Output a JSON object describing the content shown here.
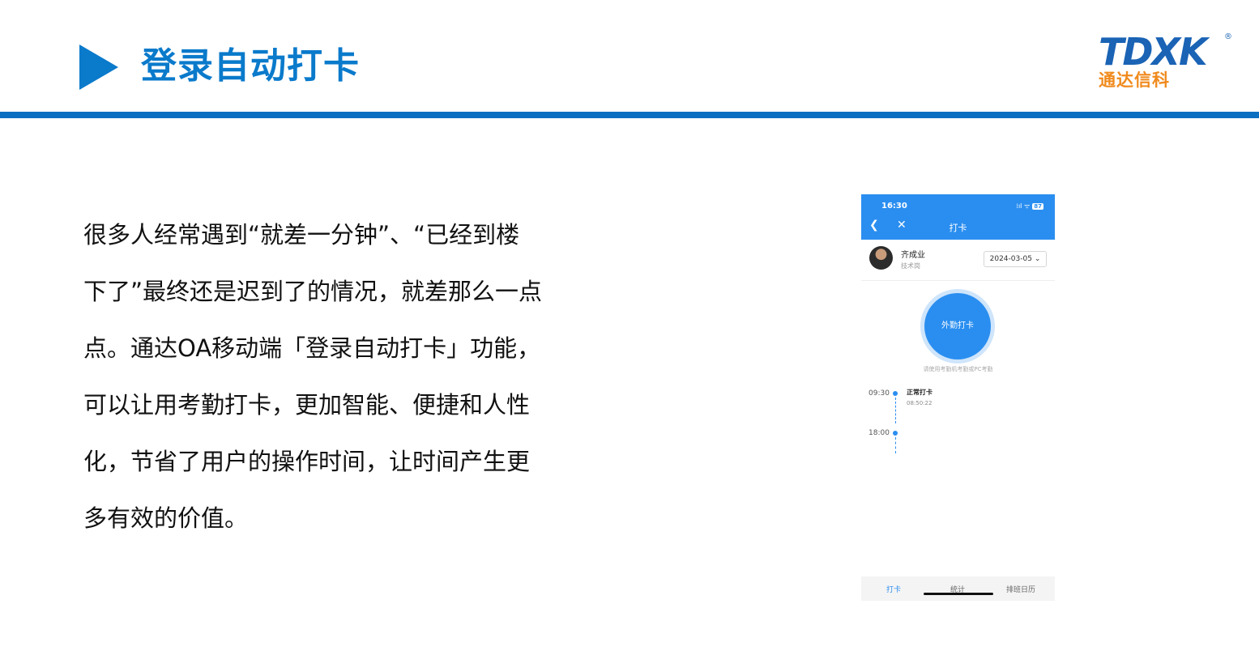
{
  "slide": {
    "title": "登录自动打卡",
    "brand": {
      "letters": "TDXK",
      "reg": "®",
      "name_cn": "通达信科",
      "colors": {
        "blue": "#1a63b5",
        "orange": "#f08a1c"
      }
    },
    "accent_color": "#0a7acb",
    "paragraph_lines": [
      "很多人经常遇到“就差一分钟”、“已经到楼",
      "下了”最终还是迟到了的情况，就差那么一点",
      "点。通达OA移动端「登录自动打卡」功能，",
      "可以让用考勤打卡，更加智能、便捷和人性",
      "化，节省了用户的操作时间，让时间产生更",
      "多有效的价值。"
    ]
  },
  "phone": {
    "status_time": "16:30",
    "signal": "⁞ıl ᯤ",
    "battery": "87",
    "nav_back_icon": "chevron-left-icon",
    "nav_close_icon": "close-icon",
    "nav_title": "打卡",
    "employee": {
      "name": "齐成业",
      "dept": "技术岗"
    },
    "date": "2024-03-05",
    "punch_button": "外勤打卡",
    "hint": "请使用考勤机考勤或PC考勤",
    "timeline": [
      {
        "time": "09:30",
        "label": "正常打卡",
        "sub": "08:50:22"
      },
      {
        "time": "18:00",
        "label": "",
        "sub": ""
      }
    ],
    "tabs": [
      "打卡",
      "统计",
      "排班日历"
    ],
    "active_tab": "打卡",
    "colors": {
      "primary": "#2a8ef0"
    }
  }
}
